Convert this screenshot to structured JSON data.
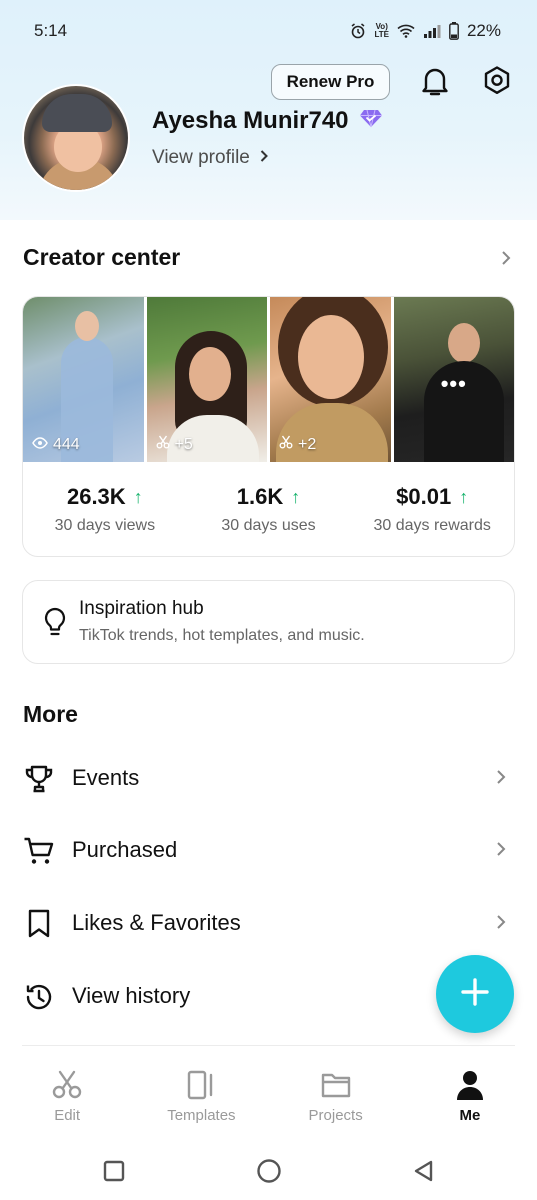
{
  "status_bar": {
    "time": "5:14",
    "battery": "22%",
    "icons": [
      "alarm-icon",
      "volte-icon",
      "wifi-icon",
      "signal-icon",
      "battery-icon"
    ],
    "volte_top": "Vo)",
    "volte_bottom": "LTE"
  },
  "header": {
    "renew_label": "Renew Pro",
    "icons": [
      "bell-icon",
      "settings-icon"
    ]
  },
  "profile": {
    "username": "Ayesha Munir740",
    "badge_icon": "pro-diamond-icon",
    "view_profile": "View profile"
  },
  "creator_center": {
    "title": "Creator center",
    "thumbnails": [
      {
        "icon": "eye-icon",
        "label": "444"
      },
      {
        "icon": "scissors-icon",
        "label": "+5"
      },
      {
        "icon": "scissors-icon",
        "label": "+2"
      },
      {
        "icon": "more-icon",
        "label": "•••"
      }
    ],
    "stats": [
      {
        "value": "26.3K",
        "label": "30 days views"
      },
      {
        "value": "1.6K",
        "label": "30 days uses"
      },
      {
        "value": "$0.01",
        "label": "30 days rewards"
      }
    ],
    "up_arrow": "↑"
  },
  "inspiration": {
    "title": "Inspiration hub",
    "subtitle": "TikTok trends, hot templates, and music."
  },
  "more": {
    "title": "More",
    "items": [
      {
        "label": "Events",
        "icon": "trophy-icon"
      },
      {
        "label": "Purchased",
        "icon": "cart-icon"
      },
      {
        "label": "Likes & Favorites",
        "icon": "bookmark-icon"
      },
      {
        "label": "View history",
        "icon": "history-icon"
      }
    ]
  },
  "fab": {
    "icon": "plus-icon"
  },
  "bottom_nav": {
    "items": [
      {
        "label": "Edit",
        "icon": "scissors-icon",
        "active": false
      },
      {
        "label": "Templates",
        "icon": "templates-icon",
        "active": false
      },
      {
        "label": "Projects",
        "icon": "folder-icon",
        "active": false
      },
      {
        "label": "Me",
        "icon": "person-icon",
        "active": true
      }
    ]
  },
  "system_nav": {
    "icons": [
      "recents-icon",
      "home-icon",
      "back-icon"
    ]
  },
  "colors": {
    "accent": "#1ec9de",
    "up_green": "#19b46e",
    "badge_purple": "#8b6cf0",
    "header_bg": "#dff1fb"
  }
}
